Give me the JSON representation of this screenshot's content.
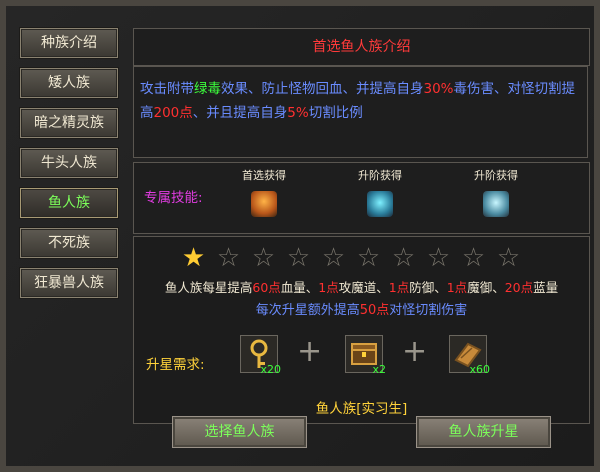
{
  "tabs": [
    {
      "label": "种族介绍",
      "active": false
    },
    {
      "label": "矮人族",
      "active": false
    },
    {
      "label": "暗之精灵族",
      "active": false
    },
    {
      "label": "牛头人族",
      "active": false
    },
    {
      "label": "鱼人族",
      "active": true
    },
    {
      "label": "不死族",
      "active": false
    },
    {
      "label": "狂暴兽人族",
      "active": false
    }
  ],
  "title": "首选鱼人族介绍",
  "description": {
    "p1": "攻击附带",
    "p2": "绿毒",
    "p3": "效果、防止怪物回血、并提高自身",
    "p4": "30%",
    "p5": "毒伤害、对怪切割提高",
    "p6": "200点",
    "p7": "、并且提高自身",
    "p8": "5%",
    "p9": "切割比例"
  },
  "skills": {
    "label": "专属技能:",
    "items": [
      {
        "caption": "首选获得",
        "icon": "flame-book-icon"
      },
      {
        "caption": "升阶获得",
        "icon": "teal-rune-icon"
      },
      {
        "caption": "升阶获得",
        "icon": "crystal-shield-icon"
      }
    ]
  },
  "stars": {
    "filled": 1,
    "total": 10
  },
  "bonus": {
    "a1": "鱼人族每星提高",
    "a2": "60点",
    "a3": "血量、",
    "a4": "1点",
    "a5": "攻魔道、",
    "a6": "1点",
    "a7": "防御、",
    "a8": "1点",
    "a9": "魔御、",
    "a10": "20点",
    "a11": "蓝量"
  },
  "extra": {
    "e1": "每次升星额外提高",
    "e2": "50点",
    "e3": "对怪切割伤害"
  },
  "requirement": {
    "label": "升星需求:",
    "items": [
      {
        "icon": "gold-key-icon",
        "count": "x20"
      },
      {
        "icon": "treasure-chest-icon",
        "count": "x2"
      },
      {
        "icon": "scroll-book-icon",
        "count": "x60"
      }
    ]
  },
  "rank": "鱼人族[实习生]",
  "buttons": {
    "select": "选择鱼人族",
    "upgrade": "鱼人族升星"
  },
  "colors": {
    "green": "#3cff3c",
    "red": "#ff3030",
    "blue": "#6a8cff",
    "gold": "#ffd23a"
  }
}
